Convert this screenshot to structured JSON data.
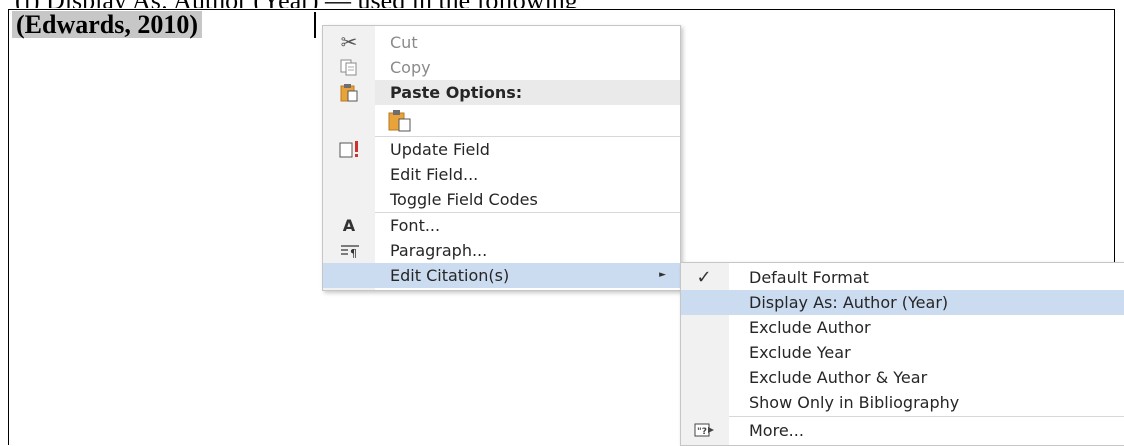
{
  "document": {
    "top_text": "(i)   Display As: Author (Year) — used in the following",
    "field_text": "(Edwards, 2010)"
  },
  "context_menu": {
    "items": [
      {
        "label": "Cut",
        "icon": "scissors-icon",
        "enabled": false
      },
      {
        "label": "Copy",
        "icon": "copy-icon",
        "enabled": false
      },
      {
        "label": "Paste Options:",
        "icon": "paste-icon"
      },
      {
        "label": "",
        "icon": "paste-keep-text-icon"
      },
      {
        "label": "Update Field",
        "icon": "update-field-icon"
      },
      {
        "label": "Edit Field...",
        "icon": ""
      },
      {
        "label": "Toggle Field Codes",
        "icon": ""
      },
      {
        "label": "Font...",
        "icon": "font-icon"
      },
      {
        "label": "Paragraph...",
        "icon": "paragraph-icon"
      },
      {
        "label": "Edit Citation(s)",
        "icon": "",
        "has_submenu": true,
        "highlighted": true
      }
    ]
  },
  "citation_submenu": {
    "items": [
      {
        "label": "Default Format",
        "icon": "checkmark-icon",
        "checked": true
      },
      {
        "label": "Display As: Author (Year)",
        "highlighted": true
      },
      {
        "label": "Exclude Author"
      },
      {
        "label": "Exclude Year"
      },
      {
        "label": "Exclude Author & Year"
      },
      {
        "label": "Show Only in Bibliography"
      },
      {
        "label": "More...",
        "icon": "more-citation-icon"
      }
    ]
  },
  "colors": {
    "highlight": "#cbdcf1",
    "gutter": "#f1f1f1",
    "field_shading": "#c7c7c7"
  }
}
